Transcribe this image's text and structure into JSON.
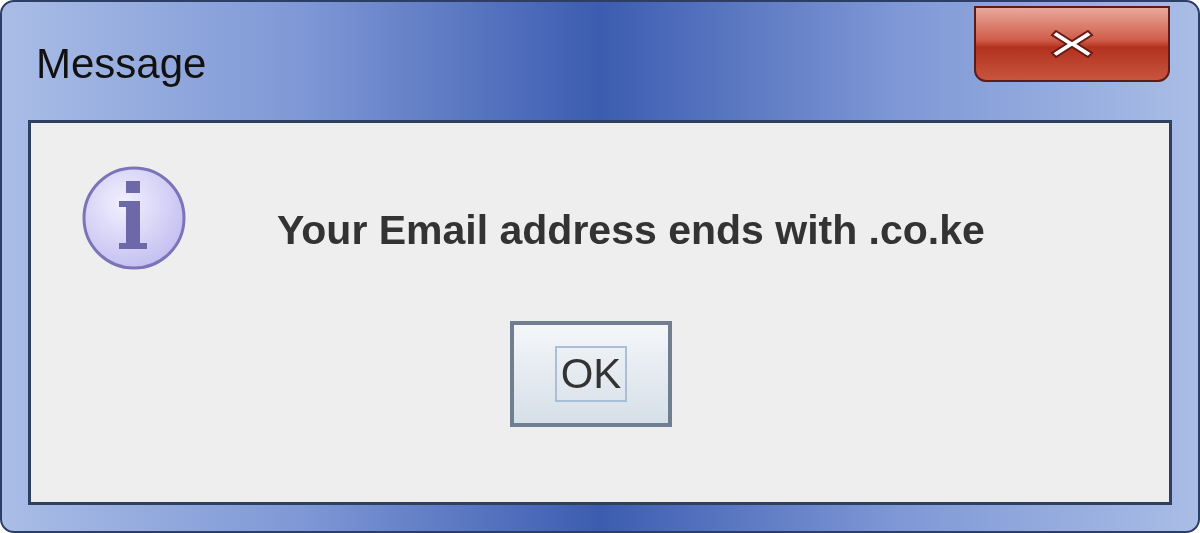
{
  "window": {
    "title": "Message"
  },
  "message": {
    "kind": "information",
    "text": "Your Email address ends with .co.ke"
  },
  "buttons": [
    {
      "label": "OK",
      "focused": true
    }
  ]
}
